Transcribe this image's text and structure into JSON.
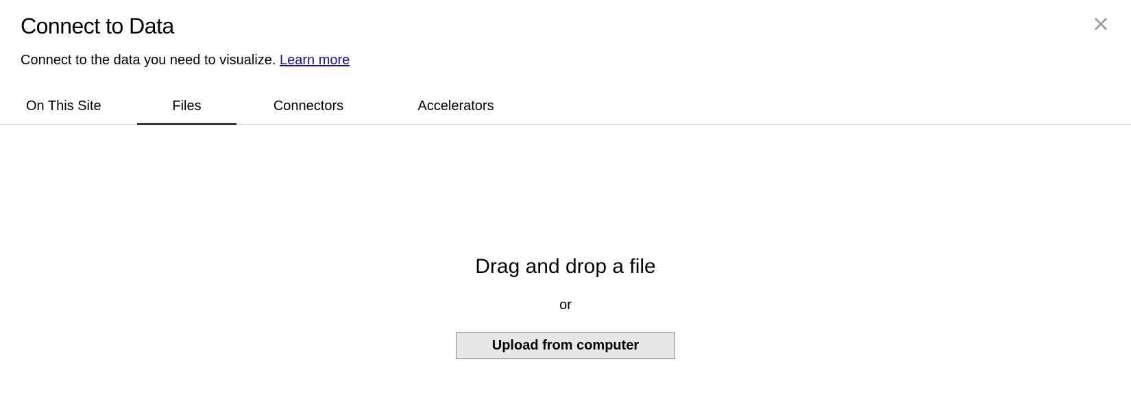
{
  "header": {
    "title": "Connect to Data",
    "subtitle": "Connect to the data you need to visualize. ",
    "learn_more": "Learn more"
  },
  "tabs": [
    {
      "label": "On This Site",
      "active": false
    },
    {
      "label": "Files",
      "active": true
    },
    {
      "label": "Connectors",
      "active": false
    },
    {
      "label": "Accelerators",
      "active": false
    }
  ],
  "content": {
    "drag_text": "Drag and drop a file",
    "or_text": "or",
    "upload_button": "Upload from computer"
  }
}
